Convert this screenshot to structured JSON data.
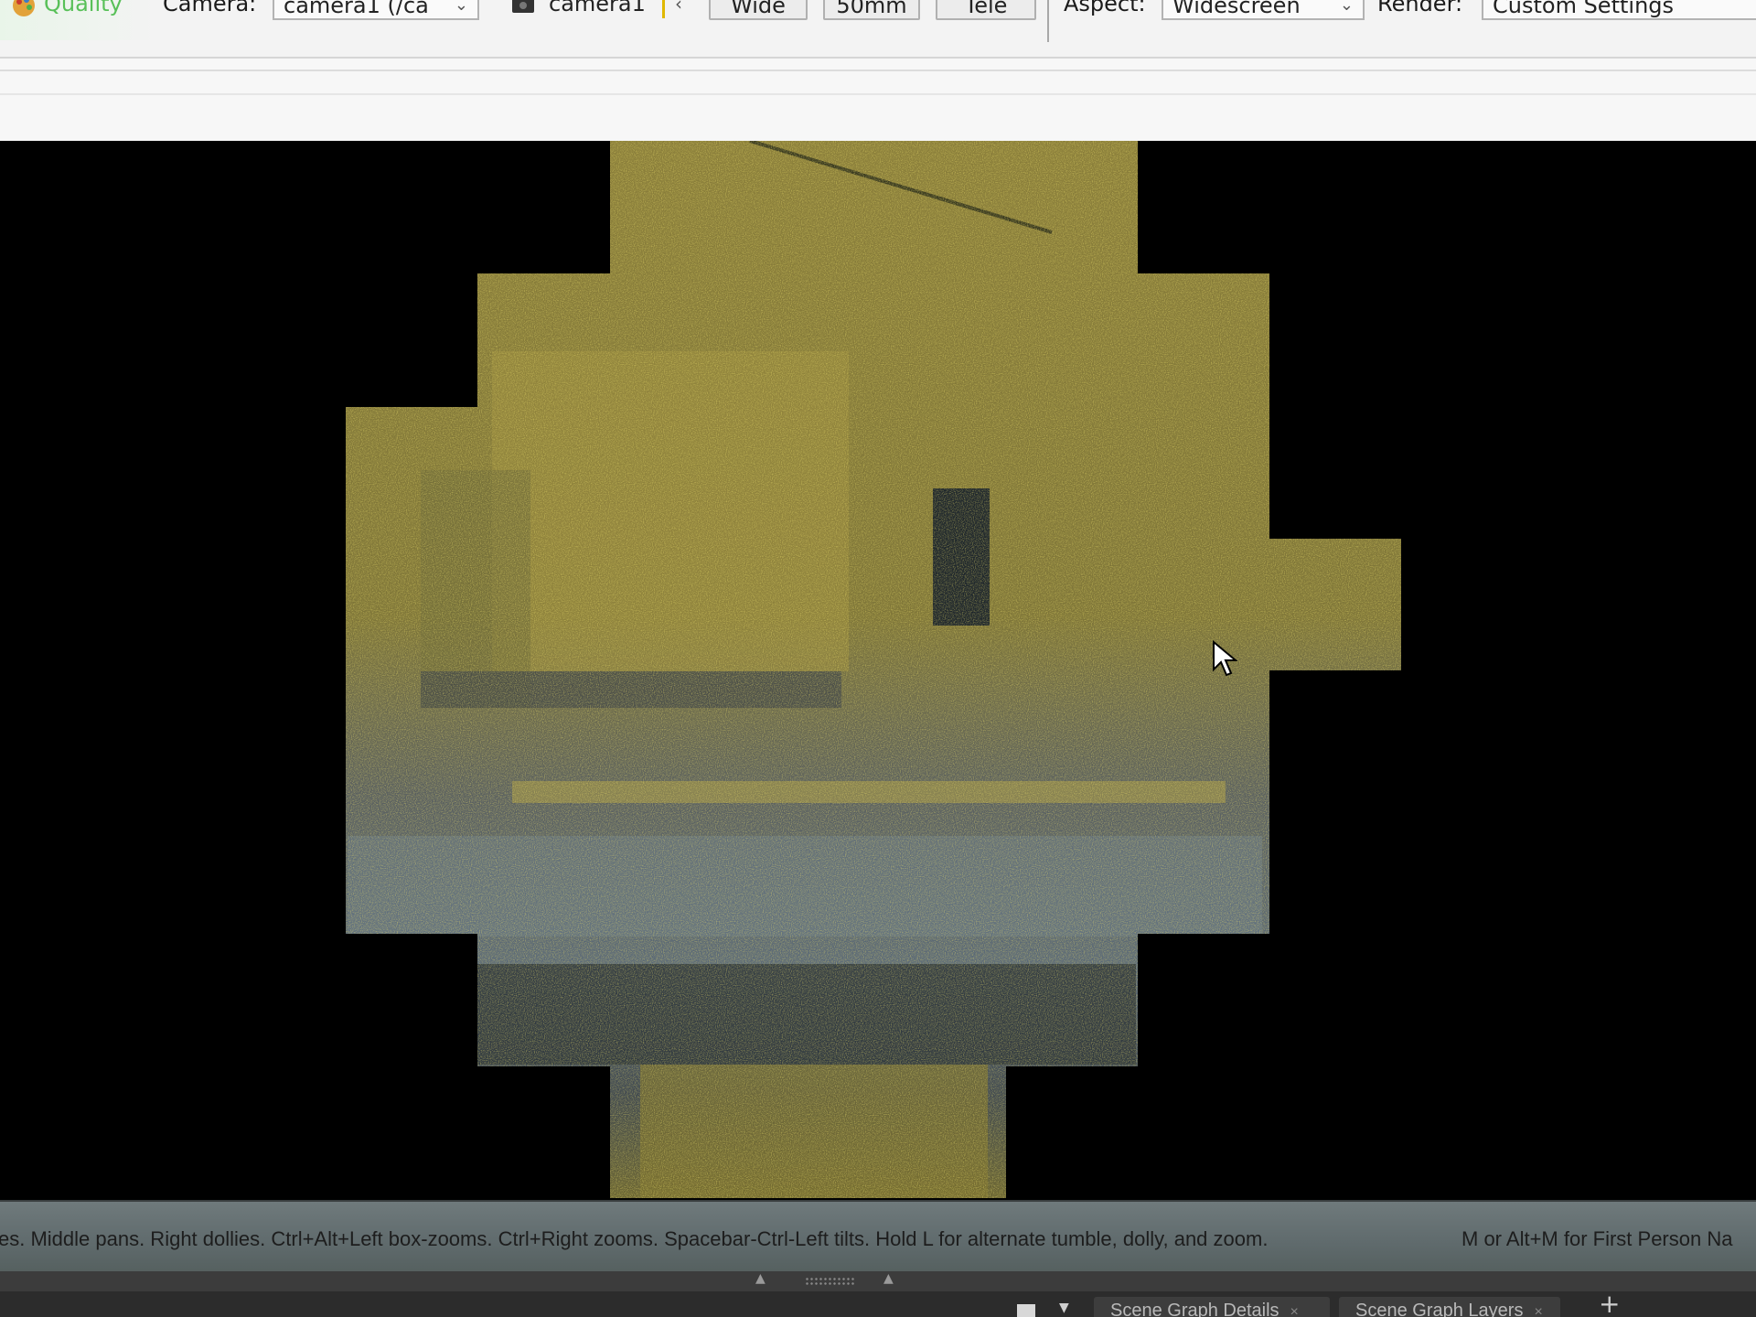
{
  "toolbar": {
    "quality_label": "Quality",
    "camera_label": "Camera:",
    "camera_value": "camera1 (/ca",
    "camera_name": "camera1",
    "lens_wide": "Wide",
    "lens_50mm": "50mm",
    "lens_tele": "Tele",
    "aspect_label": "Aspect:",
    "aspect_value": "Widescreen",
    "render_label": "Render:",
    "render_value": "Custom Settings"
  },
  "viewport": {
    "hint_text": "es. Middle pans. Right dollies. Ctrl+Alt+Left box-zooms. Ctrl+Right zooms. Spacebar-Ctrl-Left tilts. Hold L for alternate tumble, dolly, and zoom.",
    "hint_text_2": "M or Alt+M for First Person Na"
  },
  "bottom_tabs": [
    {
      "label": "Scene Graph Details"
    },
    {
      "label": "Scene Graph Layers"
    }
  ],
  "colors": {
    "accent_quality": "#58c058",
    "render_yellow": "#b3a53a",
    "render_blue": "#5c6a74",
    "background": "#000000"
  },
  "icons": {
    "quality": "palette-icon",
    "camera_lock": "camera-icon",
    "cursor": "mouse-pointer-icon",
    "add_tab": "plus-icon"
  }
}
